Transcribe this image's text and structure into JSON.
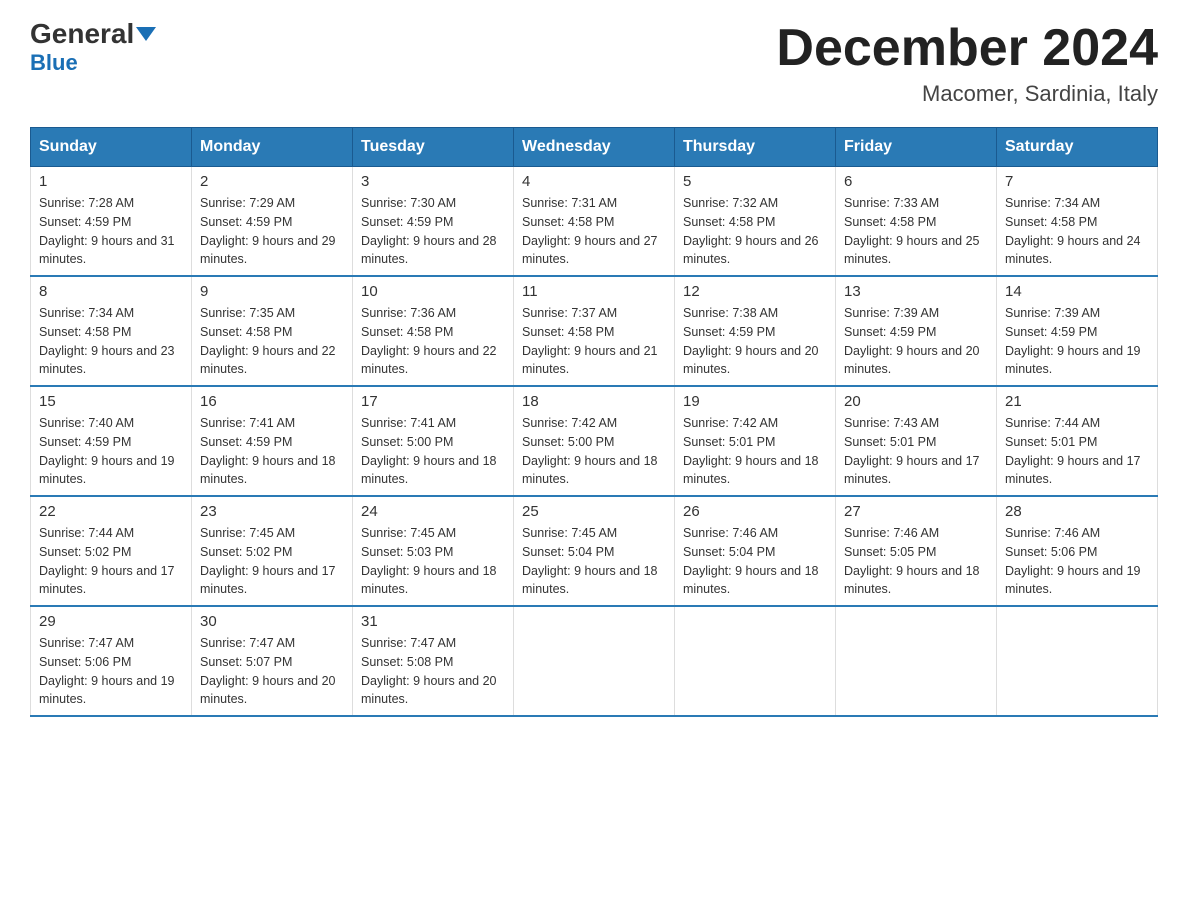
{
  "header": {
    "logo_main": "General",
    "logo_sub": "Blue",
    "month_title": "December 2024",
    "location": "Macomer, Sardinia, Italy"
  },
  "days_of_week": [
    "Sunday",
    "Monday",
    "Tuesday",
    "Wednesday",
    "Thursday",
    "Friday",
    "Saturday"
  ],
  "weeks": [
    [
      {
        "day": "1",
        "sunrise": "7:28 AM",
        "sunset": "4:59 PM",
        "daylight": "9 hours and 31 minutes."
      },
      {
        "day": "2",
        "sunrise": "7:29 AM",
        "sunset": "4:59 PM",
        "daylight": "9 hours and 29 minutes."
      },
      {
        "day": "3",
        "sunrise": "7:30 AM",
        "sunset": "4:59 PM",
        "daylight": "9 hours and 28 minutes."
      },
      {
        "day": "4",
        "sunrise": "7:31 AM",
        "sunset": "4:58 PM",
        "daylight": "9 hours and 27 minutes."
      },
      {
        "day": "5",
        "sunrise": "7:32 AM",
        "sunset": "4:58 PM",
        "daylight": "9 hours and 26 minutes."
      },
      {
        "day": "6",
        "sunrise": "7:33 AM",
        "sunset": "4:58 PM",
        "daylight": "9 hours and 25 minutes."
      },
      {
        "day": "7",
        "sunrise": "7:34 AM",
        "sunset": "4:58 PM",
        "daylight": "9 hours and 24 minutes."
      }
    ],
    [
      {
        "day": "8",
        "sunrise": "7:34 AM",
        "sunset": "4:58 PM",
        "daylight": "9 hours and 23 minutes."
      },
      {
        "day": "9",
        "sunrise": "7:35 AM",
        "sunset": "4:58 PM",
        "daylight": "9 hours and 22 minutes."
      },
      {
        "day": "10",
        "sunrise": "7:36 AM",
        "sunset": "4:58 PM",
        "daylight": "9 hours and 22 minutes."
      },
      {
        "day": "11",
        "sunrise": "7:37 AM",
        "sunset": "4:58 PM",
        "daylight": "9 hours and 21 minutes."
      },
      {
        "day": "12",
        "sunrise": "7:38 AM",
        "sunset": "4:59 PM",
        "daylight": "9 hours and 20 minutes."
      },
      {
        "day": "13",
        "sunrise": "7:39 AM",
        "sunset": "4:59 PM",
        "daylight": "9 hours and 20 minutes."
      },
      {
        "day": "14",
        "sunrise": "7:39 AM",
        "sunset": "4:59 PM",
        "daylight": "9 hours and 19 minutes."
      }
    ],
    [
      {
        "day": "15",
        "sunrise": "7:40 AM",
        "sunset": "4:59 PM",
        "daylight": "9 hours and 19 minutes."
      },
      {
        "day": "16",
        "sunrise": "7:41 AM",
        "sunset": "4:59 PM",
        "daylight": "9 hours and 18 minutes."
      },
      {
        "day": "17",
        "sunrise": "7:41 AM",
        "sunset": "5:00 PM",
        "daylight": "9 hours and 18 minutes."
      },
      {
        "day": "18",
        "sunrise": "7:42 AM",
        "sunset": "5:00 PM",
        "daylight": "9 hours and 18 minutes."
      },
      {
        "day": "19",
        "sunrise": "7:42 AM",
        "sunset": "5:01 PM",
        "daylight": "9 hours and 18 minutes."
      },
      {
        "day": "20",
        "sunrise": "7:43 AM",
        "sunset": "5:01 PM",
        "daylight": "9 hours and 17 minutes."
      },
      {
        "day": "21",
        "sunrise": "7:44 AM",
        "sunset": "5:01 PM",
        "daylight": "9 hours and 17 minutes."
      }
    ],
    [
      {
        "day": "22",
        "sunrise": "7:44 AM",
        "sunset": "5:02 PM",
        "daylight": "9 hours and 17 minutes."
      },
      {
        "day": "23",
        "sunrise": "7:45 AM",
        "sunset": "5:02 PM",
        "daylight": "9 hours and 17 minutes."
      },
      {
        "day": "24",
        "sunrise": "7:45 AM",
        "sunset": "5:03 PM",
        "daylight": "9 hours and 18 minutes."
      },
      {
        "day": "25",
        "sunrise": "7:45 AM",
        "sunset": "5:04 PM",
        "daylight": "9 hours and 18 minutes."
      },
      {
        "day": "26",
        "sunrise": "7:46 AM",
        "sunset": "5:04 PM",
        "daylight": "9 hours and 18 minutes."
      },
      {
        "day": "27",
        "sunrise": "7:46 AM",
        "sunset": "5:05 PM",
        "daylight": "9 hours and 18 minutes."
      },
      {
        "day": "28",
        "sunrise": "7:46 AM",
        "sunset": "5:06 PM",
        "daylight": "9 hours and 19 minutes."
      }
    ],
    [
      {
        "day": "29",
        "sunrise": "7:47 AM",
        "sunset": "5:06 PM",
        "daylight": "9 hours and 19 minutes."
      },
      {
        "day": "30",
        "sunrise": "7:47 AM",
        "sunset": "5:07 PM",
        "daylight": "9 hours and 20 minutes."
      },
      {
        "day": "31",
        "sunrise": "7:47 AM",
        "sunset": "5:08 PM",
        "daylight": "9 hours and 20 minutes."
      },
      null,
      null,
      null,
      null
    ]
  ]
}
